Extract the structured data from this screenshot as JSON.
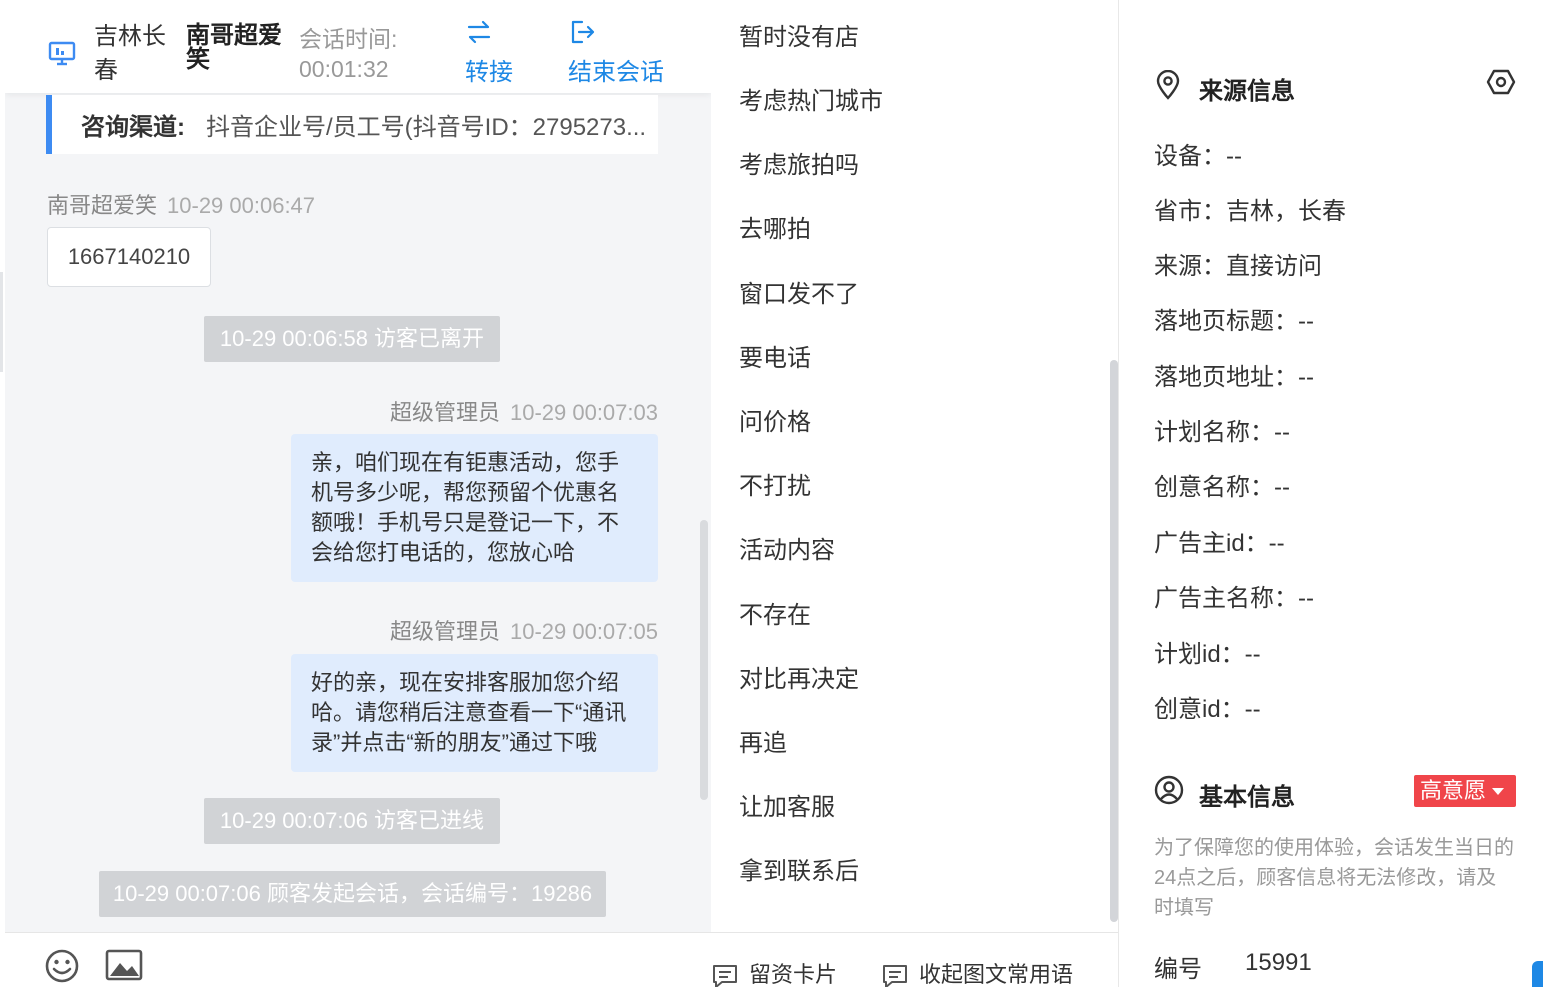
{
  "header": {
    "city": "吉林长春",
    "visitor_name": "南哥超爱笑",
    "time_label": "会话时间:",
    "time_value": "00:01:32",
    "transfer_label": "转接",
    "end_label": "结束会话"
  },
  "channel": {
    "label": "咨询渠道:",
    "value": "抖音企业号/员工号(抖音号ID：2795273..."
  },
  "messages": [
    {
      "sender": "南哥超爱笑",
      "time": "10-29 00:06:47",
      "text": "1667140210"
    },
    {
      "system": "10-29 00:06:58 访客已离开"
    },
    {
      "sender": "超级管理员",
      "time": "10-29 00:07:03",
      "text": "亲，咱们现在有钜惠活动，您手机号多少呢，帮您预留个优惠名额哦！手机号只是登记一下，不会给您打电话的，您放心哈"
    },
    {
      "sender": "超级管理员",
      "time": "10-29 00:07:05",
      "text": "好的亲，现在安排客服加您介绍哈。请您稍后注意查看一下“通讯录”并点击“新的朋友”通过下哦"
    },
    {
      "system": "10-29 00:07:06 访客已进线"
    },
    {
      "system": "10-29 00:07:06 顾客发起会话，会话编号：19286"
    }
  ],
  "quick_replies": [
    "暂时没有店",
    "考虑热门城市",
    "考虑旅拍吗",
    "去哪拍",
    "窗口发不了",
    "要电话",
    "问价格",
    "不打扰",
    "活动内容",
    "不存在",
    "对比再决定",
    "再追",
    "让加客服",
    "拿到联系后"
  ],
  "toolbar": {
    "card_label": "留资卡片",
    "collapse_label": "收起图文常用语"
  },
  "source_info": {
    "title": "来源信息",
    "fields": [
      "设备：--",
      "省市：吉林，长春",
      "来源：直接访问",
      "落地页标题：--",
      "落地页地址：--",
      "计划名称：--",
      "创意名称：--",
      "广告主id：--",
      "广告主名称：--",
      "计划id：--",
      "创意id：--"
    ]
  },
  "basic_info": {
    "title": "基本信息",
    "intent_badge": "高意愿",
    "note": "为了保障您的使用体验，会话发生当日的24点之后，顾客信息将无法修改，请及时填写",
    "id_label": "编号",
    "id_value": "15991"
  },
  "colors": {
    "accent": "#1e88e5",
    "out_bubble": "#e0ecfd",
    "badge": "#f0454a"
  }
}
